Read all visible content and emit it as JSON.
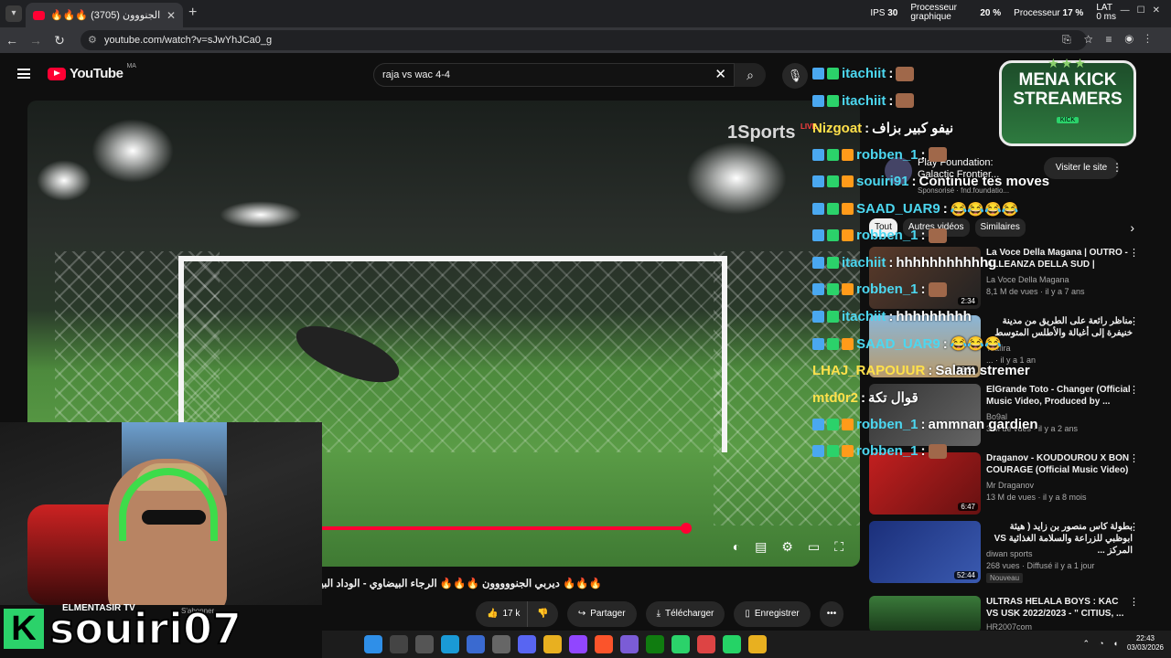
{
  "browser": {
    "tab_title": "🔥🔥🔥 (3705) ديربي الجنووون",
    "url": "youtube.com/watch?v=sJwYhJCa0_g",
    "perf": {
      "ips_label": "IPS",
      "ips_value": "30",
      "gpu_label": "Processeur graphique",
      "gpu_value": "20 %",
      "cpu_label": "Processeur",
      "cpu_value": "17 %",
      "lat_label": "LAT",
      "lat_value": "0 ms"
    }
  },
  "youtube": {
    "logo_text": "YouTube",
    "country": "MA",
    "search_value": "raja vs wac 4-4",
    "video_title": "🔥🔥🔥 ديربي الجنووووون 🔥🔥🔥 الرجاء البيضاوي - الوداد البيضاوي",
    "channel_name": "ELMENTASIR TV",
    "subscribe_label": "S'abonner",
    "actions": {
      "likes": "17 k",
      "share": "Partager",
      "download": "Télécharger",
      "save": "Enregistrer"
    },
    "sponsor": {
      "title": "Play Foundation: Galactic Frontier...",
      "sub": "Sponsorisé · fnd.foundatio...",
      "button": "Visiter le site"
    },
    "chips": [
      "Tout",
      "Autres vidéos",
      "Similaires"
    ],
    "recommendations": [
      {
        "title": "La Voce Della Magana | OUTRO - ALLEANZA DELLA SUD |",
        "channel": "La Voce Della Magana",
        "meta": "8,1 M de vues · il y a 7 ans",
        "duration": "2:34"
      },
      {
        "title": "مناظر رائعة على الطريق من مدينة خنيفرة إلى أغبالة والأطلس المتوسط",
        "channel": "Tsafira",
        "meta": "... · il y a 1 an",
        "duration": "56:51"
      },
      {
        "title": "ElGrande Toto - Changer (Official Music Video, Produced by ...",
        "channel": "Bo9al",
        "meta": "3 M de vues · il y a 2 ans",
        "duration": ""
      },
      {
        "title": "Draganov - KOUDOUROU X BON COURAGE (Official Music Video)",
        "channel": "Mr Draganov",
        "meta": "13 M de vues · il y a 8 mois",
        "duration": "6:47"
      },
      {
        "title": "بطولة كاس منصور بن زايد ( هيئة ابوظبي للزراعة والسلامة الغذائية VS المركز ...",
        "channel": "diwan sports",
        "meta": "268 vues · Diffusé il y a 1 jour",
        "duration": "52:44",
        "badge": "Nouveau"
      },
      {
        "title": "ULTRAS HELALA BOYS : KAC VS USK 2022/2023 - \" CITIUS, ...",
        "channel": "HR2007com",
        "meta": "",
        "duration": ""
      }
    ]
  },
  "stream_overlay": {
    "channel_logo_line1": "MENA KICK",
    "channel_logo_line2": "STREAMERS",
    "channel_logo_kick": "KICK",
    "streamer_name": "souiri07",
    "kick_letter": "K",
    "tv_logo": "1Sports",
    "tv_live": "LIVE",
    "chat": [
      {
        "user": "itachiit",
        "msg": "",
        "badges": [
          "blue",
          "green"
        ]
      },
      {
        "user": "itachiit",
        "msg": "",
        "badges": [
          "blue",
          "green"
        ]
      },
      {
        "user": "Nizgoat",
        "msg": "نيفو كبير بزاف",
        "badges": []
      },
      {
        "user": "robben_1",
        "msg": "",
        "badges": [
          "blue",
          "green",
          "orange"
        ]
      },
      {
        "user": "souiri91",
        "msg": "Continue tes moves",
        "badges": [
          "blue",
          "green",
          "orange"
        ]
      },
      {
        "user": "SAAD_UAR9",
        "msg": "😂😂😂😂",
        "badges": [
          "blue",
          "green",
          "orange"
        ]
      },
      {
        "user": "robben_1",
        "msg": "",
        "badges": [
          "blue",
          "green",
          "orange"
        ]
      },
      {
        "user": "itachiit",
        "msg": "hhhhhhhhhhhg",
        "badges": [
          "blue",
          "green"
        ]
      },
      {
        "user": "robben_1",
        "msg": "",
        "badges": [
          "blue",
          "green",
          "orange"
        ]
      },
      {
        "user": "itachiit",
        "msg": "hhhhhhhhh",
        "badges": [
          "blue",
          "green"
        ]
      },
      {
        "user": "SAAD_UAR9",
        "msg": "😂😂😂",
        "badges": [
          "blue",
          "green",
          "orange"
        ]
      },
      {
        "user": "LHAJ_RAPOUUR",
        "msg": "Salam stremer",
        "badges": []
      },
      {
        "user": "mtd0r2",
        "msg": "قوال تكة",
        "badges": []
      },
      {
        "user": "robben_1",
        "msg": "ammnan gardien",
        "badges": [
          "blue",
          "green",
          "orange"
        ]
      },
      {
        "user": "robben_1",
        "msg": "",
        "badges": [
          "blue",
          "green",
          "orange"
        ]
      }
    ]
  },
  "taskbar": {
    "time": "22:43",
    "date": "03/03/2026"
  },
  "colors": {
    "yt_red": "#ff0033",
    "kick_green": "#2bd26a",
    "chat_user": "#4cd7f0"
  }
}
